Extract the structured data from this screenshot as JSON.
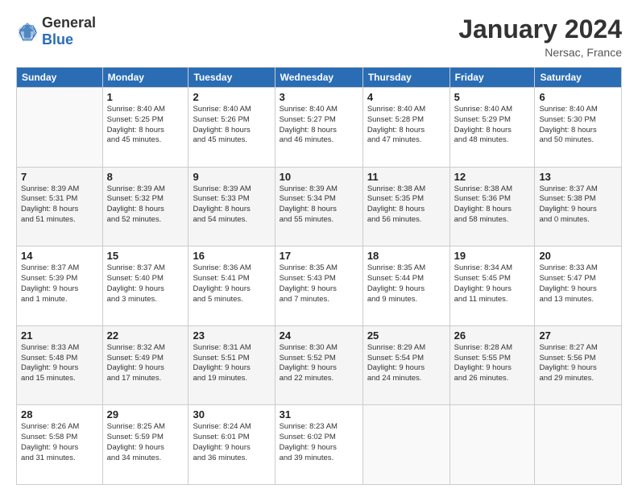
{
  "header": {
    "logo_general": "General",
    "logo_blue": "Blue",
    "month_title": "January 2024",
    "location": "Nersac, France"
  },
  "days_of_week": [
    "Sunday",
    "Monday",
    "Tuesday",
    "Wednesday",
    "Thursday",
    "Friday",
    "Saturday"
  ],
  "weeks": [
    [
      {
        "day": "",
        "info": ""
      },
      {
        "day": "1",
        "info": "Sunrise: 8:40 AM\nSunset: 5:25 PM\nDaylight: 8 hours\nand 45 minutes."
      },
      {
        "day": "2",
        "info": "Sunrise: 8:40 AM\nSunset: 5:26 PM\nDaylight: 8 hours\nand 45 minutes."
      },
      {
        "day": "3",
        "info": "Sunrise: 8:40 AM\nSunset: 5:27 PM\nDaylight: 8 hours\nand 46 minutes."
      },
      {
        "day": "4",
        "info": "Sunrise: 8:40 AM\nSunset: 5:28 PM\nDaylight: 8 hours\nand 47 minutes."
      },
      {
        "day": "5",
        "info": "Sunrise: 8:40 AM\nSunset: 5:29 PM\nDaylight: 8 hours\nand 48 minutes."
      },
      {
        "day": "6",
        "info": "Sunrise: 8:40 AM\nSunset: 5:30 PM\nDaylight: 8 hours\nand 50 minutes."
      }
    ],
    [
      {
        "day": "7",
        "info": "Sunrise: 8:39 AM\nSunset: 5:31 PM\nDaylight: 8 hours\nand 51 minutes."
      },
      {
        "day": "8",
        "info": "Sunrise: 8:39 AM\nSunset: 5:32 PM\nDaylight: 8 hours\nand 52 minutes."
      },
      {
        "day": "9",
        "info": "Sunrise: 8:39 AM\nSunset: 5:33 PM\nDaylight: 8 hours\nand 54 minutes."
      },
      {
        "day": "10",
        "info": "Sunrise: 8:39 AM\nSunset: 5:34 PM\nDaylight: 8 hours\nand 55 minutes."
      },
      {
        "day": "11",
        "info": "Sunrise: 8:38 AM\nSunset: 5:35 PM\nDaylight: 8 hours\nand 56 minutes."
      },
      {
        "day": "12",
        "info": "Sunrise: 8:38 AM\nSunset: 5:36 PM\nDaylight: 8 hours\nand 58 minutes."
      },
      {
        "day": "13",
        "info": "Sunrise: 8:37 AM\nSunset: 5:38 PM\nDaylight: 9 hours\nand 0 minutes."
      }
    ],
    [
      {
        "day": "14",
        "info": "Sunrise: 8:37 AM\nSunset: 5:39 PM\nDaylight: 9 hours\nand 1 minute."
      },
      {
        "day": "15",
        "info": "Sunrise: 8:37 AM\nSunset: 5:40 PM\nDaylight: 9 hours\nand 3 minutes."
      },
      {
        "day": "16",
        "info": "Sunrise: 8:36 AM\nSunset: 5:41 PM\nDaylight: 9 hours\nand 5 minutes."
      },
      {
        "day": "17",
        "info": "Sunrise: 8:35 AM\nSunset: 5:43 PM\nDaylight: 9 hours\nand 7 minutes."
      },
      {
        "day": "18",
        "info": "Sunrise: 8:35 AM\nSunset: 5:44 PM\nDaylight: 9 hours\nand 9 minutes."
      },
      {
        "day": "19",
        "info": "Sunrise: 8:34 AM\nSunset: 5:45 PM\nDaylight: 9 hours\nand 11 minutes."
      },
      {
        "day": "20",
        "info": "Sunrise: 8:33 AM\nSunset: 5:47 PM\nDaylight: 9 hours\nand 13 minutes."
      }
    ],
    [
      {
        "day": "21",
        "info": "Sunrise: 8:33 AM\nSunset: 5:48 PM\nDaylight: 9 hours\nand 15 minutes."
      },
      {
        "day": "22",
        "info": "Sunrise: 8:32 AM\nSunset: 5:49 PM\nDaylight: 9 hours\nand 17 minutes."
      },
      {
        "day": "23",
        "info": "Sunrise: 8:31 AM\nSunset: 5:51 PM\nDaylight: 9 hours\nand 19 minutes."
      },
      {
        "day": "24",
        "info": "Sunrise: 8:30 AM\nSunset: 5:52 PM\nDaylight: 9 hours\nand 22 minutes."
      },
      {
        "day": "25",
        "info": "Sunrise: 8:29 AM\nSunset: 5:54 PM\nDaylight: 9 hours\nand 24 minutes."
      },
      {
        "day": "26",
        "info": "Sunrise: 8:28 AM\nSunset: 5:55 PM\nDaylight: 9 hours\nand 26 minutes."
      },
      {
        "day": "27",
        "info": "Sunrise: 8:27 AM\nSunset: 5:56 PM\nDaylight: 9 hours\nand 29 minutes."
      }
    ],
    [
      {
        "day": "28",
        "info": "Sunrise: 8:26 AM\nSunset: 5:58 PM\nDaylight: 9 hours\nand 31 minutes."
      },
      {
        "day": "29",
        "info": "Sunrise: 8:25 AM\nSunset: 5:59 PM\nDaylight: 9 hours\nand 34 minutes."
      },
      {
        "day": "30",
        "info": "Sunrise: 8:24 AM\nSunset: 6:01 PM\nDaylight: 9 hours\nand 36 minutes."
      },
      {
        "day": "31",
        "info": "Sunrise: 8:23 AM\nSunset: 6:02 PM\nDaylight: 9 hours\nand 39 minutes."
      },
      {
        "day": "",
        "info": ""
      },
      {
        "day": "",
        "info": ""
      },
      {
        "day": "",
        "info": ""
      }
    ]
  ]
}
